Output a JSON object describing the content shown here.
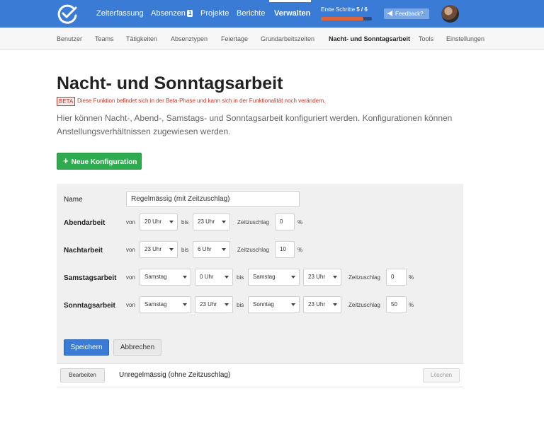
{
  "topnav": {
    "items": [
      "Zeiterfassung",
      "Absenzen",
      "Projekte",
      "Berichte",
      "Verwalten"
    ],
    "absenzen_badge": "1",
    "active": "Verwalten",
    "steps_label": "Erste Schritte",
    "steps_value": "5 / 6",
    "steps_progress": 0.83,
    "feedback": "Feedback?",
    "colors": {
      "bar": "#3a7bd5",
      "progress": "#e0643a"
    },
    "icons": {
      "logo": "checkmark-logo-icon",
      "feedback": "megaphone-icon"
    }
  },
  "subnav": {
    "items": [
      "Benutzer",
      "Teams",
      "Tätigkeiten",
      "Absenztypen",
      "Feiertage",
      "Grundarbeitszeiten",
      "Nacht- und Sonntagsarbeit",
      "Tools",
      "Einstellungen"
    ],
    "active": "Nacht- und Sonntagsarbeit"
  },
  "page": {
    "title": "Nacht- und Sonntagsarbeit",
    "beta_badge": "BETA",
    "beta_text": "Diese Funktion befindet sich in der Beta-Phase und kann sich in der Funktionalität noch verändern.",
    "description": "Hier können Nacht-, Abend-, Samstags- und Sonntagsarbeit konfiguriert werden. Konfigurationen können Anstellungsverhältnissen zugewiesen werden.",
    "new_button": "Neue Konfiguration"
  },
  "form": {
    "name_label": "Name",
    "name_value": "Regelmässig (mit Zeitzuschlag)",
    "von": "von",
    "bis": "bis",
    "zuschlag": "Zeitzuschlag",
    "percent": "%",
    "abend": {
      "label": "Abendarbeit",
      "from": "20 Uhr",
      "to": "23 Uhr",
      "value": "0"
    },
    "nacht": {
      "label": "Nachtarbeit",
      "from": "23 Uhr",
      "to": "6 Uhr",
      "value": "10"
    },
    "samstag": {
      "label": "Samstagsarbeit",
      "from_day": "Samstag",
      "from_time": "0 Uhr",
      "to_day": "Samstag",
      "to_time": "23 Uhr",
      "value": "0"
    },
    "sonntag": {
      "label": "Sonntagsarbeit",
      "from_day": "Samstag",
      "from_time": "23 Uhr",
      "to_day": "Sonntag",
      "to_time": "23 Uhr",
      "value": "50"
    },
    "save": "Speichern",
    "cancel": "Abbrechen"
  },
  "configs": [
    {
      "edit": "Bearbeiten",
      "name": "Unregelmässig (ohne Zeitzuschlag)",
      "delete": "Löschen"
    }
  ]
}
